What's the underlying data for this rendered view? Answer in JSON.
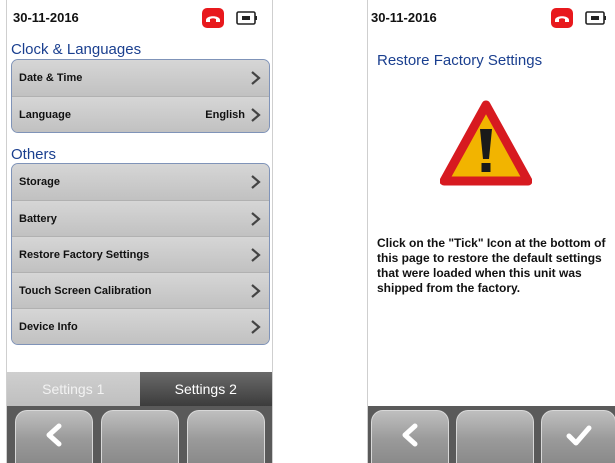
{
  "left_screen": {
    "date": "30-11-2016",
    "sections": [
      {
        "title": "Clock & Languages",
        "items": [
          {
            "label": "Date & Time",
            "value": ""
          },
          {
            "label": "Language",
            "value": "English"
          }
        ]
      },
      {
        "title": "Others",
        "items": [
          {
            "label": "Storage",
            "value": ""
          },
          {
            "label": "Battery",
            "value": ""
          },
          {
            "label": "Restore Factory Settings",
            "value": ""
          },
          {
            "label": "Touch Screen Calibration",
            "value": ""
          },
          {
            "label": "Device Info",
            "value": ""
          }
        ]
      }
    ],
    "tabs": [
      {
        "label": "Settings 1",
        "active": false
      },
      {
        "label": "Settings 2",
        "active": true
      }
    ]
  },
  "right_screen": {
    "date": "30-11-2016",
    "title": "Restore Factory Settings",
    "message": "Click on the \"Tick\" Icon at the bottom of this page to restore the default settings that were loaded when this unit was shipped from the factory."
  },
  "icons": {
    "status_call": "phone-hangup-icon",
    "status_power": "battery-plug-icon",
    "row_arrow": "chevron-right-icon",
    "back": "back-arrow-icon",
    "confirm": "tick-icon",
    "warning": "warning-triangle-icon"
  },
  "colors": {
    "accent_text": "#1a3f8f",
    "call_icon": "#e8191d",
    "warning_fill": "#f2b400",
    "warning_border": "#d71a20",
    "active_tab": "#4a4a4a"
  }
}
